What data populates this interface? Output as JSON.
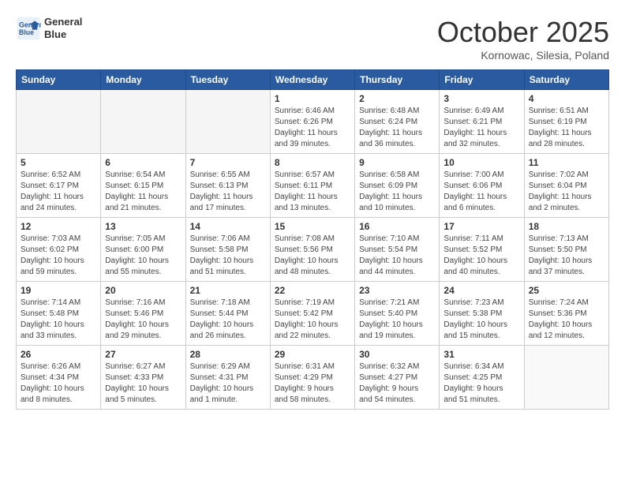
{
  "header": {
    "logo_line1": "General",
    "logo_line2": "Blue",
    "month": "October 2025",
    "location": "Kornowac, Silesia, Poland"
  },
  "days_of_week": [
    "Sunday",
    "Monday",
    "Tuesday",
    "Wednesday",
    "Thursday",
    "Friday",
    "Saturday"
  ],
  "weeks": [
    [
      {
        "day": "",
        "info": ""
      },
      {
        "day": "",
        "info": ""
      },
      {
        "day": "",
        "info": ""
      },
      {
        "day": "1",
        "info": "Sunrise: 6:46 AM\nSunset: 6:26 PM\nDaylight: 11 hours\nand 39 minutes."
      },
      {
        "day": "2",
        "info": "Sunrise: 6:48 AM\nSunset: 6:24 PM\nDaylight: 11 hours\nand 36 minutes."
      },
      {
        "day": "3",
        "info": "Sunrise: 6:49 AM\nSunset: 6:21 PM\nDaylight: 11 hours\nand 32 minutes."
      },
      {
        "day": "4",
        "info": "Sunrise: 6:51 AM\nSunset: 6:19 PM\nDaylight: 11 hours\nand 28 minutes."
      }
    ],
    [
      {
        "day": "5",
        "info": "Sunrise: 6:52 AM\nSunset: 6:17 PM\nDaylight: 11 hours\nand 24 minutes."
      },
      {
        "day": "6",
        "info": "Sunrise: 6:54 AM\nSunset: 6:15 PM\nDaylight: 11 hours\nand 21 minutes."
      },
      {
        "day": "7",
        "info": "Sunrise: 6:55 AM\nSunset: 6:13 PM\nDaylight: 11 hours\nand 17 minutes."
      },
      {
        "day": "8",
        "info": "Sunrise: 6:57 AM\nSunset: 6:11 PM\nDaylight: 11 hours\nand 13 minutes."
      },
      {
        "day": "9",
        "info": "Sunrise: 6:58 AM\nSunset: 6:09 PM\nDaylight: 11 hours\nand 10 minutes."
      },
      {
        "day": "10",
        "info": "Sunrise: 7:00 AM\nSunset: 6:06 PM\nDaylight: 11 hours\nand 6 minutes."
      },
      {
        "day": "11",
        "info": "Sunrise: 7:02 AM\nSunset: 6:04 PM\nDaylight: 11 hours\nand 2 minutes."
      }
    ],
    [
      {
        "day": "12",
        "info": "Sunrise: 7:03 AM\nSunset: 6:02 PM\nDaylight: 10 hours\nand 59 minutes."
      },
      {
        "day": "13",
        "info": "Sunrise: 7:05 AM\nSunset: 6:00 PM\nDaylight: 10 hours\nand 55 minutes."
      },
      {
        "day": "14",
        "info": "Sunrise: 7:06 AM\nSunset: 5:58 PM\nDaylight: 10 hours\nand 51 minutes."
      },
      {
        "day": "15",
        "info": "Sunrise: 7:08 AM\nSunset: 5:56 PM\nDaylight: 10 hours\nand 48 minutes."
      },
      {
        "day": "16",
        "info": "Sunrise: 7:10 AM\nSunset: 5:54 PM\nDaylight: 10 hours\nand 44 minutes."
      },
      {
        "day": "17",
        "info": "Sunrise: 7:11 AM\nSunset: 5:52 PM\nDaylight: 10 hours\nand 40 minutes."
      },
      {
        "day": "18",
        "info": "Sunrise: 7:13 AM\nSunset: 5:50 PM\nDaylight: 10 hours\nand 37 minutes."
      }
    ],
    [
      {
        "day": "19",
        "info": "Sunrise: 7:14 AM\nSunset: 5:48 PM\nDaylight: 10 hours\nand 33 minutes."
      },
      {
        "day": "20",
        "info": "Sunrise: 7:16 AM\nSunset: 5:46 PM\nDaylight: 10 hours\nand 29 minutes."
      },
      {
        "day": "21",
        "info": "Sunrise: 7:18 AM\nSunset: 5:44 PM\nDaylight: 10 hours\nand 26 minutes."
      },
      {
        "day": "22",
        "info": "Sunrise: 7:19 AM\nSunset: 5:42 PM\nDaylight: 10 hours\nand 22 minutes."
      },
      {
        "day": "23",
        "info": "Sunrise: 7:21 AM\nSunset: 5:40 PM\nDaylight: 10 hours\nand 19 minutes."
      },
      {
        "day": "24",
        "info": "Sunrise: 7:23 AM\nSunset: 5:38 PM\nDaylight: 10 hours\nand 15 minutes."
      },
      {
        "day": "25",
        "info": "Sunrise: 7:24 AM\nSunset: 5:36 PM\nDaylight: 10 hours\nand 12 minutes."
      }
    ],
    [
      {
        "day": "26",
        "info": "Sunrise: 6:26 AM\nSunset: 4:34 PM\nDaylight: 10 hours\nand 8 minutes."
      },
      {
        "day": "27",
        "info": "Sunrise: 6:27 AM\nSunset: 4:33 PM\nDaylight: 10 hours\nand 5 minutes."
      },
      {
        "day": "28",
        "info": "Sunrise: 6:29 AM\nSunset: 4:31 PM\nDaylight: 10 hours\nand 1 minute."
      },
      {
        "day": "29",
        "info": "Sunrise: 6:31 AM\nSunset: 4:29 PM\nDaylight: 9 hours\nand 58 minutes."
      },
      {
        "day": "30",
        "info": "Sunrise: 6:32 AM\nSunset: 4:27 PM\nDaylight: 9 hours\nand 54 minutes."
      },
      {
        "day": "31",
        "info": "Sunrise: 6:34 AM\nSunset: 4:25 PM\nDaylight: 9 hours\nand 51 minutes."
      },
      {
        "day": "",
        "info": ""
      }
    ]
  ]
}
